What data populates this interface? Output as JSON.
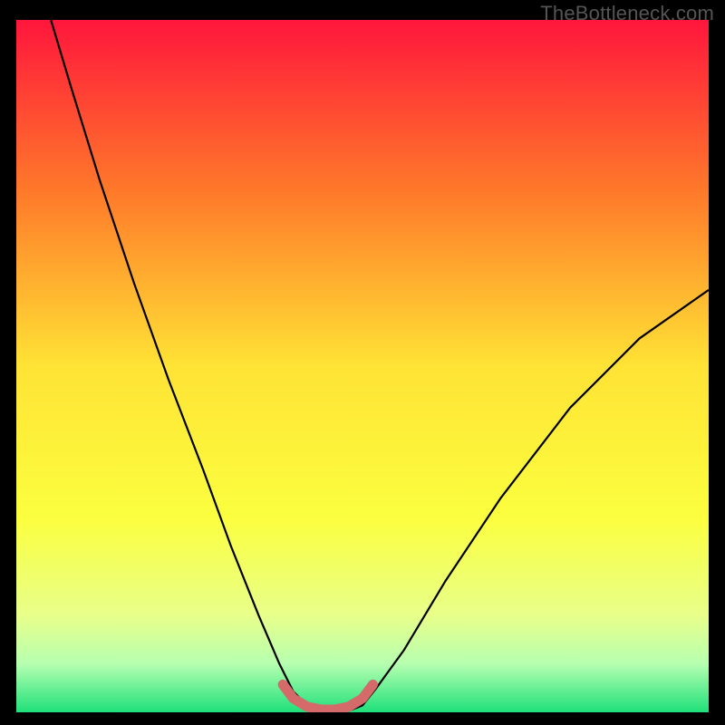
{
  "watermark": "TheBottleneck.com",
  "chart_data": {
    "type": "line",
    "title": "",
    "xlabel": "",
    "ylabel": "",
    "xlim": [
      0,
      100
    ],
    "ylim": [
      0,
      100
    ],
    "gradient_stops": [
      {
        "offset": 0,
        "color": "#ff163c"
      },
      {
        "offset": 25,
        "color": "#ff7a2a"
      },
      {
        "offset": 50,
        "color": "#ffe335"
      },
      {
        "offset": 72,
        "color": "#fbff3f"
      },
      {
        "offset": 86,
        "color": "#e8ff8a"
      },
      {
        "offset": 93,
        "color": "#b6ffb0"
      },
      {
        "offset": 100,
        "color": "#1fe07a"
      }
    ],
    "series": [
      {
        "name": "bottleneck-curve",
        "color": "#000000",
        "width": 2.2,
        "points": [
          {
            "x": 5.0,
            "y": 100.0
          },
          {
            "x": 8.0,
            "y": 90.0
          },
          {
            "x": 12.0,
            "y": 77.0
          },
          {
            "x": 17.0,
            "y": 62.0
          },
          {
            "x": 22.0,
            "y": 48.0
          },
          {
            "x": 27.0,
            "y": 35.0
          },
          {
            "x": 31.0,
            "y": 24.0
          },
          {
            "x": 35.0,
            "y": 14.0
          },
          {
            "x": 38.0,
            "y": 7.0
          },
          {
            "x": 40.0,
            "y": 3.0
          },
          {
            "x": 42.0,
            "y": 1.0
          },
          {
            "x": 45.0,
            "y": 0.2
          },
          {
            "x": 48.0,
            "y": 0.2
          },
          {
            "x": 50.0,
            "y": 1.0
          },
          {
            "x": 52.0,
            "y": 3.5
          },
          {
            "x": 56.0,
            "y": 9.0
          },
          {
            "x": 62.0,
            "y": 19.0
          },
          {
            "x": 70.0,
            "y": 31.0
          },
          {
            "x": 80.0,
            "y": 44.0
          },
          {
            "x": 90.0,
            "y": 54.0
          },
          {
            "x": 100.0,
            "y": 61.0
          }
        ]
      },
      {
        "name": "flat-zone-highlight",
        "color": "#d46a6a",
        "width": 11,
        "cap": "round",
        "points": [
          {
            "x": 38.5,
            "y": 4.0
          },
          {
            "x": 40.0,
            "y": 2.0
          },
          {
            "x": 42.0,
            "y": 0.8
          },
          {
            "x": 44.0,
            "y": 0.4
          },
          {
            "x": 46.0,
            "y": 0.4
          },
          {
            "x": 48.0,
            "y": 0.8
          },
          {
            "x": 50.0,
            "y": 2.0
          },
          {
            "x": 51.5,
            "y": 4.0
          }
        ]
      }
    ]
  }
}
